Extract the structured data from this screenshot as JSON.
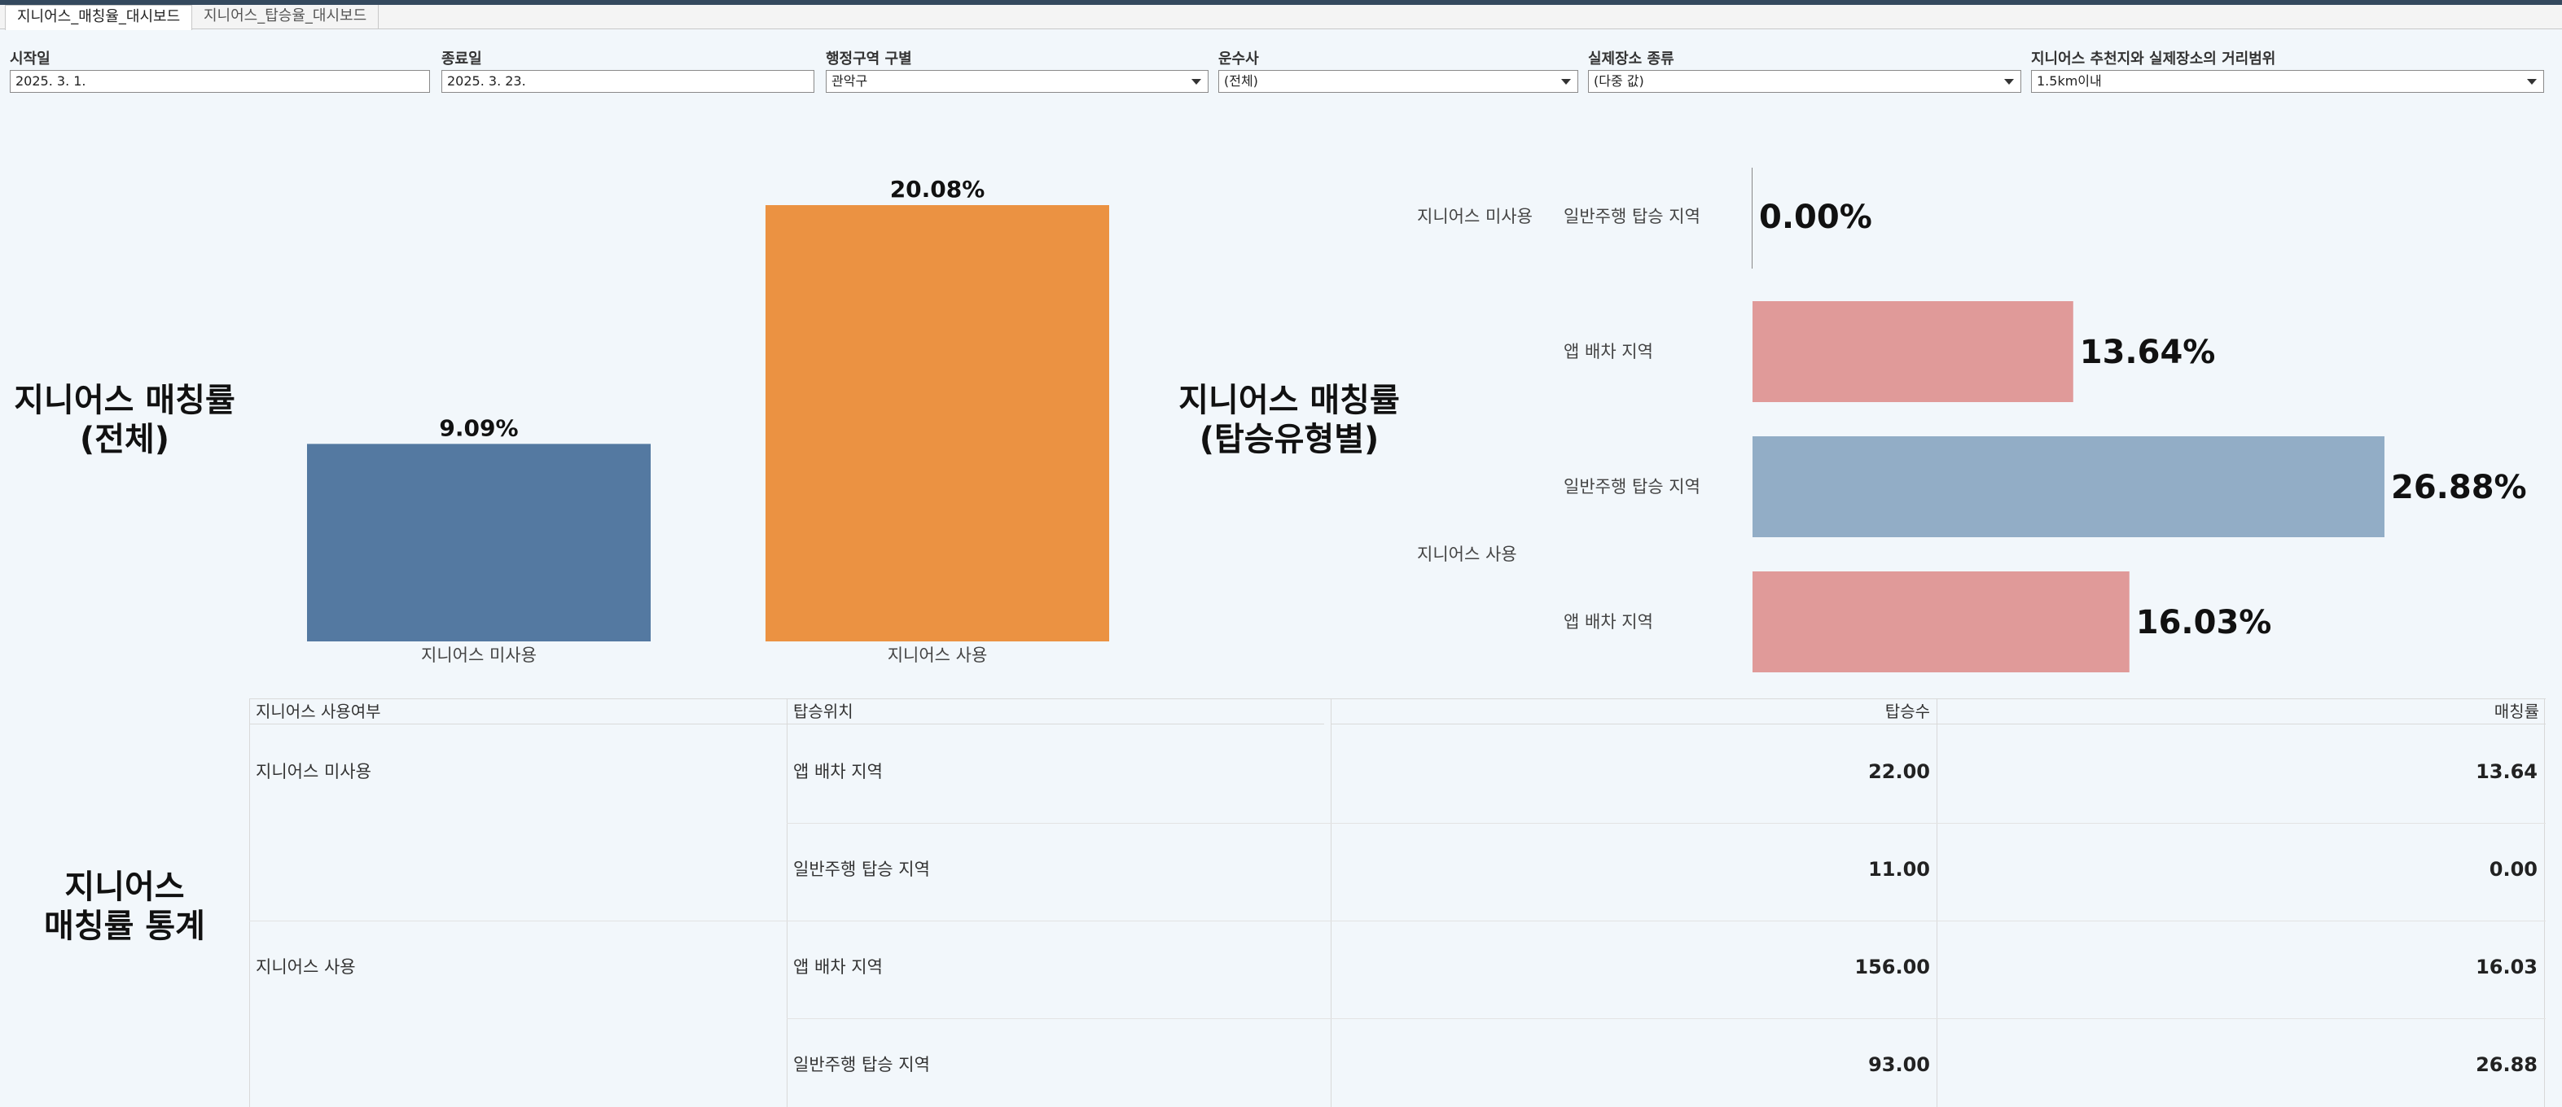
{
  "tabs": [
    {
      "label": "지니어스_매칭율_대시보드",
      "active": true
    },
    {
      "label": "지니어스_탑승율_대시보드",
      "active": false
    }
  ],
  "filters": {
    "start_date": {
      "label": "시작일",
      "value": "2025. 3. 1."
    },
    "end_date": {
      "label": "종료일",
      "value": "2025. 3. 23."
    },
    "district": {
      "label": "행정구역 구별",
      "value": "관악구"
    },
    "operator": {
      "label": "운수사",
      "value": "(전체)"
    },
    "place_type": {
      "label": "실제장소 종류",
      "value": "(다중 값)"
    },
    "distance": {
      "label": "지니어스 추천지와 실제장소의 거리범위",
      "value": "1.5km이내"
    }
  },
  "section_titles": {
    "overall": [
      "지니어스 매칭률",
      "(전체)"
    ],
    "by_type": [
      "지니어스 매칭률",
      "(탑승유형별)"
    ],
    "stats": [
      "지니어스",
      "매칭률 통계"
    ]
  },
  "colors": {
    "blue": "#5479a1",
    "orange": "#eb9242",
    "pink": "#e09a99",
    "lightblue": "#92adc6",
    "background": "#f2f7fb"
  },
  "chart_data": [
    {
      "type": "bar",
      "orientation": "vertical",
      "categories": [
        "지니어스 미사용",
        "지니어스 사용"
      ],
      "values": [
        9.09,
        20.08
      ],
      "labels": [
        "9.09%",
        "20.08%"
      ],
      "colors": [
        "#5479a1",
        "#eb9242"
      ],
      "ylim": [
        0,
        20.08
      ]
    },
    {
      "type": "bar",
      "orientation": "horizontal",
      "groups": [
        {
          "name": "지니어스 미사용",
          "rows": [
            {
              "category": "일반주행 탑승 지역",
              "value": 0.0,
              "label": "0.00%",
              "color": "#92adc6"
            },
            {
              "category": "앱 배차 지역",
              "value": 13.64,
              "label": "13.64%",
              "color": "#e09a99"
            }
          ]
        },
        {
          "name": "지니어스 사용",
          "rows": [
            {
              "category": "일반주행 탑승 지역",
              "value": 26.88,
              "label": "26.88%",
              "color": "#92adc6"
            },
            {
              "category": "앱 배차 지역",
              "value": 16.03,
              "label": "16.03%",
              "color": "#e09a99"
            }
          ]
        }
      ],
      "xlim": [
        0,
        26.88
      ]
    }
  ],
  "table": {
    "headers": [
      "지니어스 사용여부",
      "탑승위치",
      "탑승수",
      "매칭률"
    ],
    "groups": [
      {
        "name": "지니어스 미사용",
        "rows": [
          {
            "location": "앱 배차 지역",
            "count": "22.00",
            "rate": "13.64"
          },
          {
            "location": "일반주행 탑승 지역",
            "count": "11.00",
            "rate": "0.00"
          }
        ]
      },
      {
        "name": "지니어스 사용",
        "rows": [
          {
            "location": "앱 배차 지역",
            "count": "156.00",
            "rate": "16.03"
          },
          {
            "location": "일반주행 탑승 지역",
            "count": "93.00",
            "rate": "26.88"
          }
        ]
      }
    ]
  }
}
